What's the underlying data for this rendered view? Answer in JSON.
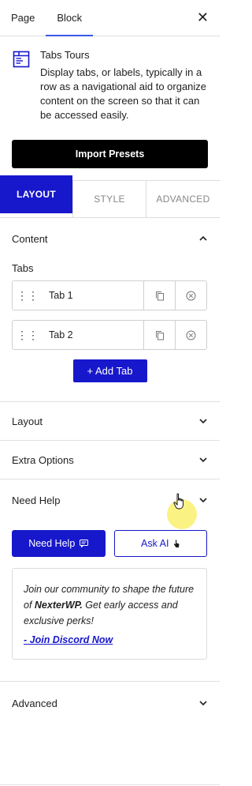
{
  "inspector": {
    "tabs": [
      "Page",
      "Block"
    ],
    "active_tab": "Block"
  },
  "block": {
    "title": "Tabs Tours",
    "description": "Display tabs, or labels, typically in a row as a navigational aid to organize content on the screen so that it can be accessed easily.",
    "icon": "tabs-block-icon"
  },
  "import_presets_label": "Import Presets",
  "settings_tabs": [
    "LAYOUT",
    "STYLE",
    "ADVANCED"
  ],
  "content_section": {
    "title": "Content",
    "tabs_label": "Tabs",
    "items": [
      {
        "name": "Tab 1"
      },
      {
        "name": "Tab 2"
      }
    ],
    "add_tab_label": "+ Add Tab"
  },
  "sections": {
    "layout": "Layout",
    "extra_options": "Extra Options",
    "need_help": "Need Help",
    "advanced": "Advanced"
  },
  "help": {
    "need_help_button": "Need Help",
    "ask_ai_button": "Ask AI",
    "community_text_1": "Join our community to shape the future of ",
    "community_brand": "NexterWP.",
    "community_text_2": " Get early access and exclusive perks!",
    "discord_link": "- Join Discord Now"
  },
  "colors": {
    "accent": "#1717cc",
    "wp_blue": "#3858e9",
    "black_button": "#000000",
    "cursor_highlight": "#faf06e"
  }
}
